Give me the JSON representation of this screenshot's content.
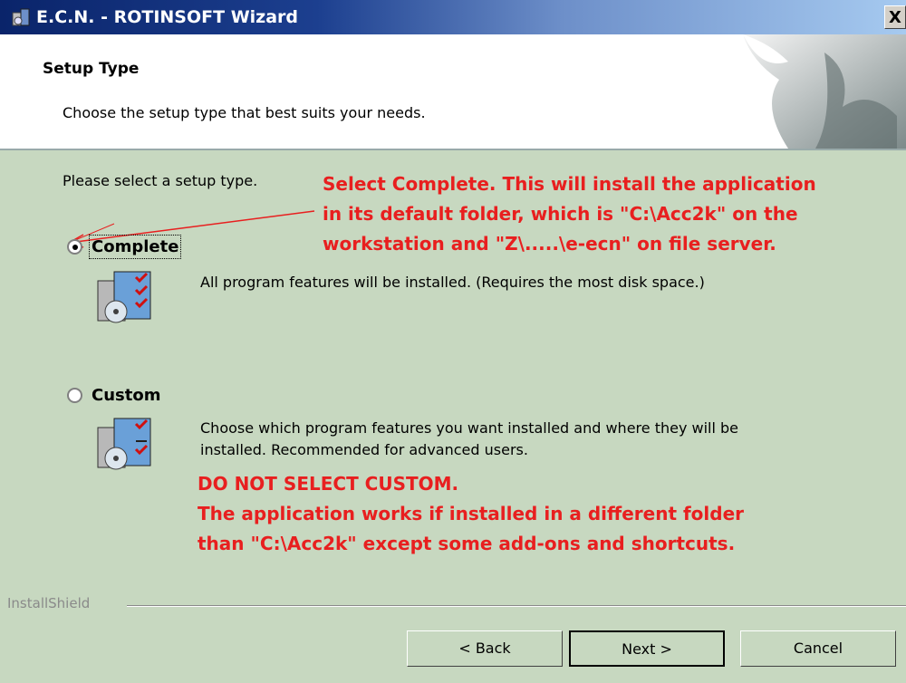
{
  "window": {
    "title": "E.C.N. - ROTINSOFT Wizard",
    "close_label": "X"
  },
  "banner": {
    "title": "Setup Type",
    "subtitle": "Choose the setup type that best suits your needs."
  },
  "body": {
    "prompt": "Please select a setup type.",
    "annotation_top": "Select Complete. This will install the application\nin its default folder, which is \"C:\\Acc2k\" on the\nworkstation and \"Z\\.....\\e-ecn\" on file server.",
    "annotation_bottom": "DO NOT SELECT CUSTOM.\nThe application works if installed in a different folder\nthan \"C:\\Acc2k\" except some add-ons and shortcuts.",
    "options": [
      {
        "label": "Complete",
        "selected": true,
        "description": "All program features will be installed. (Requires the most disk space.)"
      },
      {
        "label": "Custom",
        "selected": false,
        "description": "Choose which program features you want installed and where they will be installed. Recommended for advanced users."
      }
    ]
  },
  "footer": {
    "brand": "InstallShield",
    "back_label": "< Back",
    "next_label": "Next >",
    "cancel_label": "Cancel"
  },
  "colors": {
    "annotation": "#e81f1f",
    "dialog_bg": "#c7d8c0",
    "title_bar_start": "#0a246a"
  }
}
